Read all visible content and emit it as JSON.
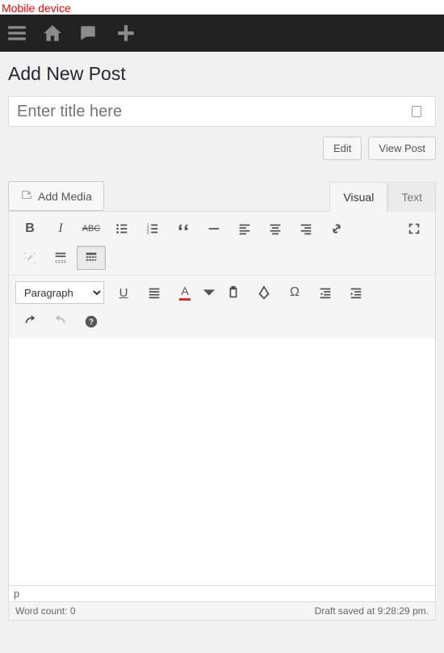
{
  "device_label": "Mobile device",
  "page_title": "Add New Post",
  "title_placeholder": "Enter title here",
  "permalink": {
    "edit": "Edit",
    "view": "View Post"
  },
  "media_button": "Add Media",
  "tabs": {
    "visual": "Visual",
    "text": "Text"
  },
  "format_select": "Paragraph",
  "editor_path": "p",
  "status": {
    "word_count_label": "Word count: ",
    "word_count": "0",
    "draft_saved": "Draft saved at 9:28:29 pm."
  }
}
